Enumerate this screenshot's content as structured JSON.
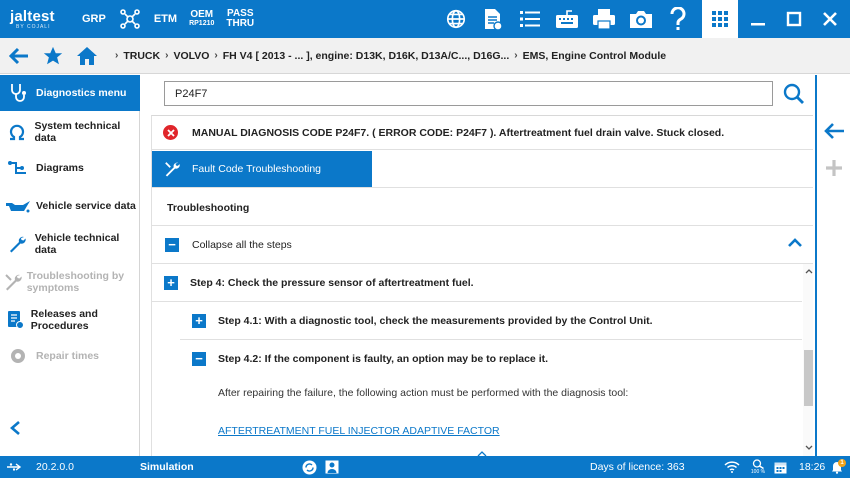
{
  "app": {
    "logo_main": "jaltest",
    "logo_sub": "BY COJALI",
    "nav": {
      "grp": "GRP",
      "etm": "ETM",
      "oem_top": "OEM",
      "oem_bottom": "RP1210",
      "pass_top": "PASS",
      "pass_bottom": "THRU"
    }
  },
  "breadcrumb": [
    "TRUCK",
    "VOLVO",
    "FH V4 [ 2013 - ... ], engine: D13K, D16K, D13A/C..., D16G...",
    "EMS, Engine Control Module"
  ],
  "sidebar": {
    "items": [
      {
        "label": "Diagnostics menu",
        "state": "active"
      },
      {
        "label": "System technical data",
        "state": "normal"
      },
      {
        "label": "Diagrams",
        "state": "normal"
      },
      {
        "label": "Vehicle service data",
        "state": "normal"
      },
      {
        "label": "Vehicle technical data",
        "state": "normal"
      },
      {
        "label": "Troubleshooting by symptoms",
        "state": "disabled"
      },
      {
        "label": "Releases and Procedures",
        "state": "normal"
      },
      {
        "label": "Repair times",
        "state": "disabled"
      }
    ]
  },
  "search": {
    "value": "P24F7",
    "help_label": "?"
  },
  "diagnosis": {
    "error_text": "MANUAL DIAGNOSIS CODE P24F7. ( ERROR CODE: P24F7 ). Aftertreatment fuel drain valve. Stuck closed.",
    "tab_label": "Fault Code Troubleshooting",
    "section_title": "Troubleshooting",
    "collapse_label": "Collapse all the steps",
    "steps": [
      {
        "label": "Step 4: Check the pressure sensor of aftertreatment fuel.",
        "sign": "+"
      },
      {
        "label": "Step 4.1: With a diagnostic tool, check the measurements provided by the Control Unit.",
        "sign": "+"
      },
      {
        "label": "Step 4.2: If the component is faulty, an option may be to replace it.",
        "sign": "−"
      }
    ],
    "step_body": "After repairing the failure, the following action must be performed with the diagnosis tool:",
    "step_link": "AFTERTREATMENT FUEL INJECTOR ADAPTIVE FACTOR"
  },
  "status": {
    "version": "20.2.0.0",
    "mode": "Simulation",
    "licence": "Days of licence: 363",
    "battery": "100 %",
    "time": "18:26",
    "notifications": "1"
  },
  "colors": {
    "primary": "#0b78c9",
    "error": "#e0262b",
    "disabled": "#b3b3b3"
  }
}
